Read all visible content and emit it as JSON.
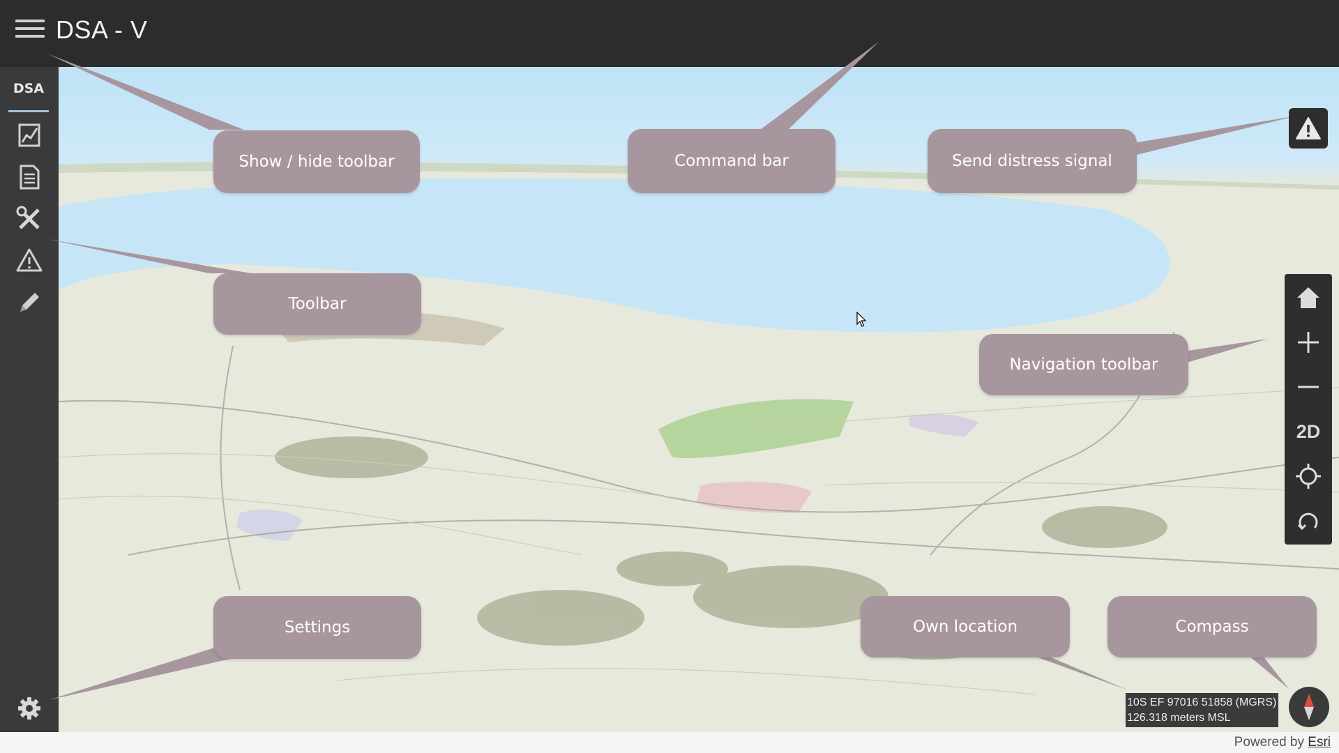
{
  "header": {
    "title": "DSA - V"
  },
  "sidebar": {
    "tab_label": "DSA",
    "items": [
      {
        "icon": "report-chart-icon"
      },
      {
        "icon": "document-icon"
      },
      {
        "icon": "tools-icon"
      },
      {
        "icon": "warning-icon"
      },
      {
        "icon": "pencil-icon"
      }
    ],
    "settings_icon": "gear-icon"
  },
  "callouts": {
    "show_hide_toolbar": "Show / hide toolbar",
    "command_bar": "Command bar",
    "send_distress": "Send distress signal",
    "toolbar": "Toolbar",
    "navigation_toolbar": "Navigation toolbar",
    "settings": "Settings",
    "own_location": "Own location",
    "compass": "Compass"
  },
  "navigation": {
    "two_d_label": "2D"
  },
  "location": {
    "mgrs": "10S EF 97016 51858 (MGRS)",
    "altitude": "126.318 meters MSL"
  },
  "footer": {
    "powered_by": "Powered by",
    "esri": "Esri"
  },
  "colors": {
    "callout": "#a8969f",
    "toolbar": "#2c2c2c",
    "water": "#c6e6f8"
  }
}
